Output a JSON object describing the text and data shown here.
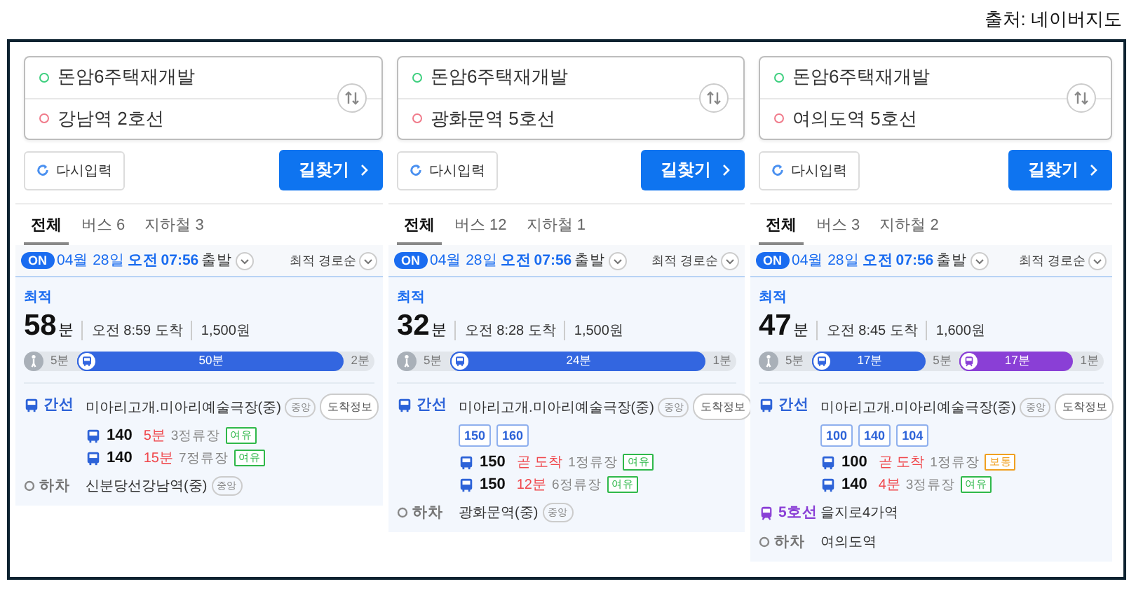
{
  "source_caption": "출처: 네이버지도",
  "panels": [
    {
      "from": "돈암6주택재개발",
      "to": "강남역 2호선",
      "reset_button": "다시입력",
      "search_button": "길찾기",
      "tabs": [
        {
          "label": "전체",
          "selected": true
        },
        {
          "label": "버스 6",
          "selected": false
        },
        {
          "label": "지하철 3",
          "selected": false
        }
      ],
      "departure": {
        "badge": "ON",
        "date": "04월 28일",
        "period": "오전",
        "time": "07:56",
        "suffix": "출발"
      },
      "sort": "최적 경로순",
      "route": {
        "tag": "최적",
        "minutes": "58",
        "unit": "분",
        "arrival": "오전 8:59 도착",
        "fare": "1,500원",
        "segments": [
          {
            "kind": "walk_start",
            "label": "5분"
          },
          {
            "kind": "bus",
            "label": "50분",
            "color": "#3366e0"
          },
          {
            "kind": "walk",
            "label": "2분"
          }
        ],
        "steps": [
          {
            "kind": "bus",
            "line": "간선",
            "color": "#2d63d8",
            "stop": "미아리고개.미아리예술극장(중)",
            "stop_tag": "중앙",
            "info_button": "도착정보",
            "arrivals": [
              {
                "bus": "140",
                "eta": "5분",
                "stops": "3정류장",
                "crowd": "여유",
                "color": "#2fb84a"
              },
              {
                "bus": "140",
                "eta": "15분",
                "stops": "7정류장",
                "crowd": "여유",
                "color": "#2fb84a"
              }
            ]
          },
          {
            "kind": "alight",
            "line": "하차",
            "stop": "신분당선강남역(중)",
            "stop_tag": "중앙"
          }
        ]
      }
    },
    {
      "from": "돈암6주택재개발",
      "to": "광화문역 5호선",
      "reset_button": "다시입력",
      "search_button": "길찾기",
      "tabs": [
        {
          "label": "전체",
          "selected": true
        },
        {
          "label": "버스 12",
          "selected": false
        },
        {
          "label": "지하철 1",
          "selected": false
        }
      ],
      "departure": {
        "badge": "ON",
        "date": "04월 28일",
        "period": "오전",
        "time": "07:56",
        "suffix": "출발"
      },
      "sort": "최적 경로순",
      "route": {
        "tag": "최적",
        "minutes": "32",
        "unit": "분",
        "arrival": "오전 8:28 도착",
        "fare": "1,500원",
        "segments": [
          {
            "kind": "walk_start",
            "label": "5분"
          },
          {
            "kind": "bus",
            "label": "24분",
            "color": "#3366e0"
          },
          {
            "kind": "walk",
            "label": "1분"
          }
        ],
        "steps": [
          {
            "kind": "bus",
            "line": "간선",
            "color": "#2d63d8",
            "stop": "미아리고개.미아리예술극장(중)",
            "stop_tag": "중앙",
            "info_button": "도착정보",
            "route_chips": [
              "150",
              "160"
            ],
            "arrivals": [
              {
                "bus": "150",
                "eta": "곧 도착",
                "stops": "1정류장",
                "crowd": "여유",
                "color": "#2fb84a"
              },
              {
                "bus": "150",
                "eta": "12분",
                "stops": "6정류장",
                "crowd": "여유",
                "color": "#2fb84a"
              }
            ]
          },
          {
            "kind": "alight",
            "line": "하차",
            "stop": "광화문역(중)",
            "stop_tag": "중앙"
          }
        ]
      }
    },
    {
      "from": "돈암6주택재개발",
      "to": "여의도역 5호선",
      "reset_button": "다시입력",
      "search_button": "길찾기",
      "tabs": [
        {
          "label": "전체",
          "selected": true
        },
        {
          "label": "버스 3",
          "selected": false
        },
        {
          "label": "지하철 2",
          "selected": false
        }
      ],
      "departure": {
        "badge": "ON",
        "date": "04월 28일",
        "period": "오전",
        "time": "07:56",
        "suffix": "출발"
      },
      "sort": "최적 경로순",
      "route": {
        "tag": "최적",
        "minutes": "47",
        "unit": "분",
        "arrival": "오전 8:45 도착",
        "fare": "1,600원",
        "segments": [
          {
            "kind": "walk_start",
            "label": "5분"
          },
          {
            "kind": "bus",
            "label": "17분",
            "color": "#3366e0"
          },
          {
            "kind": "walk",
            "label": "5분"
          },
          {
            "kind": "subway",
            "label": "17분",
            "color": "#8a3fd6"
          },
          {
            "kind": "walk",
            "label": "1분"
          }
        ],
        "steps": [
          {
            "kind": "bus",
            "line": "간선",
            "color": "#2d63d8",
            "stop": "미아리고개.미아리예술극장(중)",
            "stop_tag": "중앙",
            "info_button": "도착정보",
            "route_chips": [
              "100",
              "140",
              "104"
            ],
            "arrivals": [
              {
                "bus": "100",
                "eta": "곧 도착",
                "stops": "1정류장",
                "crowd": "보통",
                "color": "#f0a020"
              },
              {
                "bus": "140",
                "eta": "4분",
                "stops": "3정류장",
                "crowd": "여유",
                "color": "#2fb84a"
              }
            ]
          },
          {
            "kind": "subway",
            "line": "5호선",
            "color": "#8a3fd6",
            "stop": "을지로4가역"
          },
          {
            "kind": "alight",
            "line": "하차",
            "stop": "여의도역"
          }
        ]
      }
    }
  ]
}
